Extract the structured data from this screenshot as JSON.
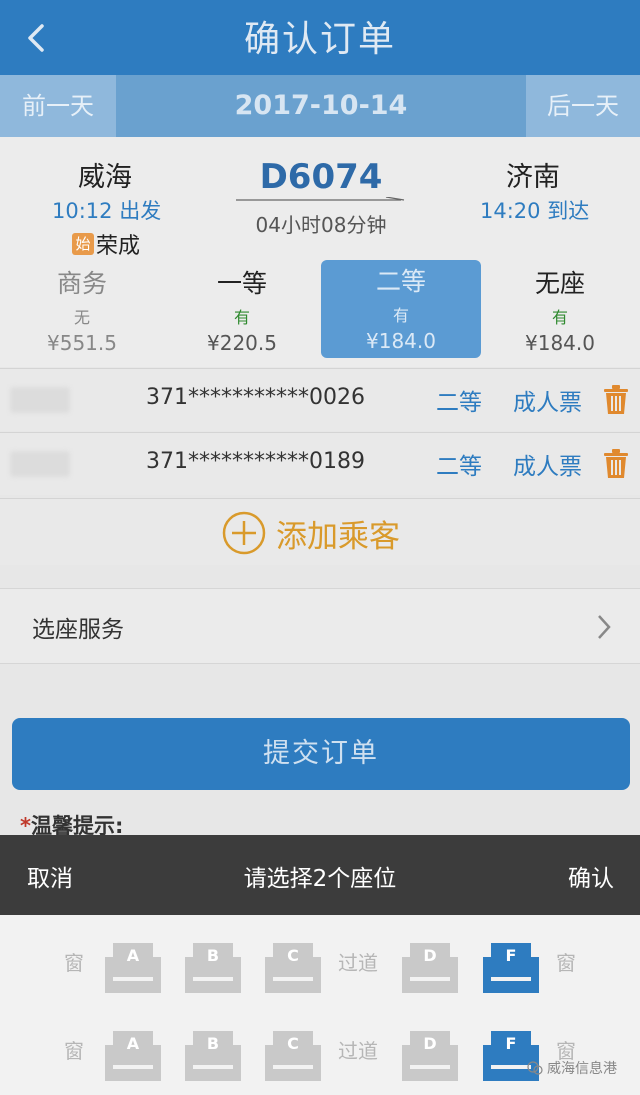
{
  "header": {
    "title": "确认订单"
  },
  "datebar": {
    "prev_label": "前一天",
    "date": "2017-10-14",
    "next_label": "后一天"
  },
  "train": {
    "from_city": "威海",
    "from_time": "10:12 出发",
    "origin_tag": "始",
    "origin_station": "荣成",
    "number": "D6074",
    "duration": "04小时08分钟",
    "to_city": "济南",
    "to_time": "14:20 到达"
  },
  "seat_classes": [
    {
      "name": "商务",
      "availability": "无",
      "price": "¥551.5"
    },
    {
      "name": "一等",
      "availability": "有",
      "price": "¥220.5"
    },
    {
      "name": "二等",
      "availability": "有",
      "price": "¥184.0"
    },
    {
      "name": "无座",
      "availability": "有",
      "price": "¥184.0"
    }
  ],
  "passengers": [
    {
      "id_number": "371***********0026",
      "seat_class": "二等",
      "ticket_type": "成人票"
    },
    {
      "id_number": "371***********0189",
      "seat_class": "二等",
      "ticket_type": "成人票"
    }
  ],
  "add_passenger_label": "添加乘客",
  "service": {
    "label": "选座服务"
  },
  "submit_label": "提交订单",
  "tip_label": "温馨提示:",
  "picker": {
    "cancel_label": "取消",
    "title": "请选择2个座位",
    "confirm_label": "确认",
    "window_label": "窗",
    "aisle_label": "过道",
    "rows": [
      {
        "seats": [
          "A",
          "B",
          "C",
          "D",
          "F"
        ],
        "selected": "F"
      },
      {
        "seats": [
          "A",
          "B",
          "C",
          "D",
          "F"
        ],
        "selected": "F"
      }
    ]
  },
  "watermark": "威海信息港",
  "colors": {
    "primary": "#2e7cc0",
    "accent": "#d99a2b",
    "selected_seat": "#5b9bd3",
    "delete": "#e0892e"
  },
  "icons": {
    "back": "chevron-left-icon",
    "delete": "trash-icon",
    "add": "plus-circle-icon",
    "service_arrow": "chevron-right-icon"
  }
}
